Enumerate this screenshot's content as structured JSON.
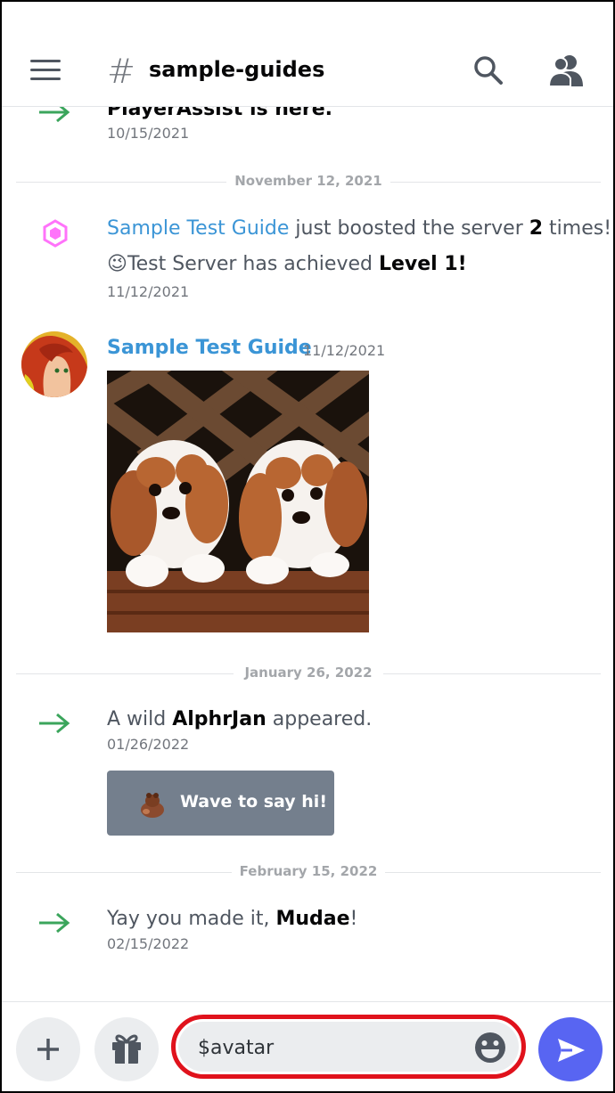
{
  "header": {
    "channel_name": "sample-guides",
    "hash_symbol": "#",
    "icons": [
      "hamburger-menu-icon",
      "hash-icon",
      "search-icon",
      "members-icon"
    ]
  },
  "messages": {
    "welcome_1": {
      "text_partial": "PlayerAssist is here.",
      "timestamp": "10/15/2021"
    },
    "divider_1": "November 12, 2021",
    "boost": {
      "user": "Sample Test Guide",
      "text_mid": " just boosted the server ",
      "count": "2",
      "text_end": " times!",
      "emoji": "😉",
      "achieved_prefix": "Test Server has achieved ",
      "level": "Level 1!",
      "timestamp": "11/12/2021"
    },
    "image_post": {
      "author": "Sample Test Guide",
      "timestamp": "11/12/2021"
    },
    "divider_2": "January 26, 2022",
    "welcome_2": {
      "prefix": "A wild ",
      "user": "AlphrJan",
      "suffix": " appeared.",
      "timestamp": "01/26/2022",
      "wave_button": "Wave to say hi!"
    },
    "divider_3": "February 15, 2022",
    "welcome_3": {
      "prefix": "Yay you made it, ",
      "user": "Mudae",
      "suffix": "!",
      "timestamp": "02/15/2022"
    }
  },
  "composer": {
    "value": "$avatar",
    "highlight_color": "#e0121c",
    "send_color": "#5865f2"
  },
  "colors": {
    "link": "#3b95d6",
    "welcome_arrow": "#3ba55c",
    "boost_gem": "#ff73fa",
    "wave_button": "#747f8d"
  }
}
